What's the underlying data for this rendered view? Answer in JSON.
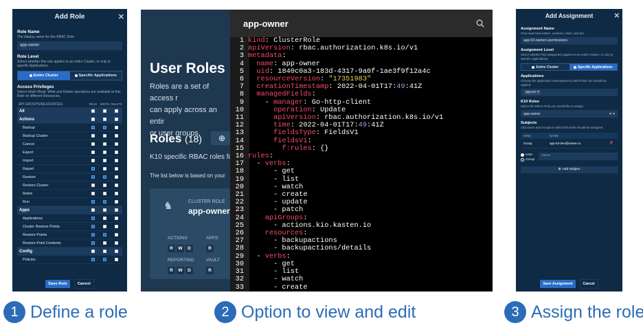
{
  "panel1": {
    "title": "Add Role",
    "role_name_label": "Role Name",
    "role_name_help": "The display name for this RBAC Role.",
    "role_name_value": "app-owner",
    "role_level_label": "Role Level",
    "role_level_help": "Select whether this role applies to an entire Cluster, or only to specific Applications.",
    "opt_cluster": "Entire Cluster",
    "opt_apps": "Specific Applications",
    "access_label": "Access Privileges",
    "access_help": "Select which Read, Write and Delete operations are available to this Role on different Resources.",
    "col_name": "API GROUPS/RESOURCES",
    "col_read": "READ",
    "col_write": "WRITE",
    "col_delete": "DELETE",
    "rows": [
      {
        "name": "All",
        "group": true,
        "r": false,
        "w": false,
        "d": false
      },
      {
        "name": "Actions",
        "group": true,
        "r": false,
        "w": false,
        "d": false
      },
      {
        "name": "Backup",
        "group": false,
        "r": true,
        "w": true,
        "d": false
      },
      {
        "name": "Backup Cluster",
        "group": false,
        "r": false,
        "w": false,
        "d": false
      },
      {
        "name": "Cancel",
        "group": false,
        "r": false,
        "w": false,
        "d": false
      },
      {
        "name": "Export",
        "group": false,
        "r": false,
        "w": false,
        "d": false
      },
      {
        "name": "Import",
        "group": false,
        "r": false,
        "w": false,
        "d": false
      },
      {
        "name": "Report",
        "group": false,
        "r": true,
        "w": false,
        "d": false
      },
      {
        "name": "Restore",
        "group": false,
        "r": true,
        "w": true,
        "d": false
      },
      {
        "name": "Restore Cluster",
        "group": false,
        "r": false,
        "w": false,
        "d": false
      },
      {
        "name": "Retire",
        "group": false,
        "r": false,
        "w": false,
        "d": false
      },
      {
        "name": "Run",
        "group": false,
        "r": true,
        "w": true,
        "d": false
      },
      {
        "name": "Apps",
        "group": true,
        "r": false,
        "w": false,
        "d": false
      },
      {
        "name": "Applications",
        "group": false,
        "r": true,
        "w": false,
        "d": false
      },
      {
        "name": "Cluster Restore Points",
        "group": false,
        "r": true,
        "w": false,
        "d": false
      },
      {
        "name": "Restore Points",
        "group": false,
        "r": true,
        "w": true,
        "d": false
      },
      {
        "name": "Restore Point Contents",
        "group": false,
        "r": true,
        "w": false,
        "d": false
      },
      {
        "name": "Config",
        "group": true,
        "r": false,
        "w": false,
        "d": false
      },
      {
        "name": "Policies",
        "group": false,
        "r": true,
        "w": true,
        "d": false
      }
    ],
    "save": "Save Role",
    "cancel": "Cancel"
  },
  "panel2": {
    "page_title": "User Roles",
    "desc": "Roles are a set of access r... can apply across an entire... or user groups.",
    "desc_lines": [
      "Roles are a set of access r",
      "can apply across an entir",
      "or user groups."
    ],
    "roles_title": "Roles",
    "roles_count": "(18)",
    "k10_text": "K10 specific RBAC roles fo",
    "list_text": "The list below is based on your",
    "card": {
      "type": "CLUSTER ROLE",
      "name": "app-owner",
      "g1": "ACTIONS",
      "g2": "APPS",
      "g3": "REPORTING",
      "g4": "VAULT",
      "r": "R",
      "w": "W",
      "d": "D"
    },
    "editor_title": "app-owner",
    "code": [
      [
        [
          "k",
          "kind"
        ],
        [
          "t",
          ": ClusterRole"
        ]
      ],
      [
        [
          "k",
          "apiVersion"
        ],
        [
          "t",
          ": rbac.authorization.k8s.io/v1"
        ]
      ],
      [
        [
          "k",
          "metadata"
        ],
        [
          "t",
          ":"
        ]
      ],
      [
        [
          "t",
          "  "
        ],
        [
          "k",
          "name"
        ],
        [
          "t",
          ": app-owner"
        ]
      ],
      [
        [
          "t",
          "  "
        ],
        [
          "k",
          "uid"
        ],
        [
          "t",
          ": 1840c0a3-183d-4317-9a0f-1ae3f9f12a4c"
        ]
      ],
      [
        [
          "t",
          "  "
        ],
        [
          "k",
          "resourceVersion"
        ],
        [
          "t",
          ": "
        ],
        [
          "s",
          "\"17351983\""
        ]
      ],
      [
        [
          "t",
          "  "
        ],
        [
          "k",
          "creationTimestamp"
        ],
        [
          "t",
          ": 2022-04-01T17:"
        ],
        [
          "pu",
          "49"
        ],
        [
          "t",
          ":41Z"
        ]
      ],
      [
        [
          "t",
          "  "
        ],
        [
          "k",
          "managedFields"
        ],
        [
          "t",
          ":"
        ]
      ],
      [
        [
          "t",
          "    - "
        ],
        [
          "k",
          "manager"
        ],
        [
          "t",
          ": Go-http-client"
        ]
      ],
      [
        [
          "t",
          "      "
        ],
        [
          "k",
          "operation"
        ],
        [
          "t",
          ": Update"
        ]
      ],
      [
        [
          "t",
          "      "
        ],
        [
          "k",
          "apiVersion"
        ],
        [
          "t",
          ": rbac.authorization.k8s.io/v1"
        ]
      ],
      [
        [
          "t",
          "      "
        ],
        [
          "k",
          "time"
        ],
        [
          "t",
          ": 2022-04-01T17:"
        ],
        [
          "pu",
          "49"
        ],
        [
          "t",
          ":41Z"
        ]
      ],
      [
        [
          "t",
          "      "
        ],
        [
          "k",
          "fieldsType"
        ],
        [
          "t",
          ": FieldsV1"
        ]
      ],
      [
        [
          "t",
          "      "
        ],
        [
          "k",
          "fieldsV1"
        ],
        [
          "t",
          ":"
        ]
      ],
      [
        [
          "t",
          "        "
        ],
        [
          "k",
          "f:rules"
        ],
        [
          "t",
          ": {}"
        ]
      ],
      [
        [
          "k",
          "rules"
        ],
        [
          "t",
          ":"
        ]
      ],
      [
        [
          "t",
          "  - "
        ],
        [
          "k",
          "verbs"
        ],
        [
          "t",
          ":"
        ]
      ],
      [
        [
          "t",
          "      - get"
        ]
      ],
      [
        [
          "t",
          "      - list"
        ]
      ],
      [
        [
          "t",
          "      - watch"
        ]
      ],
      [
        [
          "t",
          "      - create"
        ]
      ],
      [
        [
          "t",
          "      - update"
        ]
      ],
      [
        [
          "t",
          "      - patch"
        ]
      ],
      [
        [
          "t",
          "    "
        ],
        [
          "k",
          "apiGroups"
        ],
        [
          "t",
          ":"
        ]
      ],
      [
        [
          "t",
          "      - actions.kio.kasten.io"
        ]
      ],
      [
        [
          "t",
          "    "
        ],
        [
          "k",
          "resources"
        ],
        [
          "t",
          ":"
        ]
      ],
      [
        [
          "t",
          "      - backupactions"
        ]
      ],
      [
        [
          "t",
          "      - backupactions/details"
        ]
      ],
      [
        [
          "t",
          "  - "
        ],
        [
          "k",
          "verbs"
        ],
        [
          "t",
          ":"
        ]
      ],
      [
        [
          "t",
          "      - get"
        ]
      ],
      [
        [
          "t",
          "      - list"
        ]
      ],
      [
        [
          "t",
          "      - watch"
        ]
      ],
      [
        [
          "t",
          "      - create"
        ]
      ]
    ]
  },
  "panel3": {
    "title": "Add Assignment",
    "name_label": "Assignment Name",
    "name_help": "Only lowercase letters, numbers, dash, and dot.",
    "name_value": "app-53-owners-permissions",
    "level_label": "Assignment Level",
    "level_help": "Select whether this assignment applies to an entire Cluster, or only to specific Applications.",
    "opt_cluster": "Entire Cluster",
    "opt_apps": "Specific Applications",
    "apps_label": "Applications",
    "apps_help": "Choose the application namespaces to which this role should be applied.",
    "app_tag": "app-53",
    "roles_label": "K10 Roles",
    "roles_help": "Select the RBAC Role you would like to assign.",
    "role_value": "app-owner",
    "subjects_label": "Subjects",
    "subjects_help": "Add Users and Groups to which this Role should be assigned.",
    "col_kind": "KIND",
    "col_name": "NAME",
    "subject_kind": "Group",
    "subject_name": "app-53-dev@kasten.io",
    "radio_user": "User",
    "radio_group": "Group",
    "name_placeholder": "Name",
    "add_subject": "Add Subject",
    "save": "Save Assignment",
    "cancel": "Cancel"
  },
  "captions": [
    {
      "num": "1",
      "text": "Define a role"
    },
    {
      "num": "2",
      "text": "Option to view and edit"
    },
    {
      "num": "3",
      "text": "Assign the role"
    }
  ],
  "colors": {
    "accent": "#2b6cb8",
    "panel_bg": "#0f2a44",
    "editor_key": "#f34e6a",
    "editor_string": "#f3d44b",
    "editor_number": "#b894ff"
  }
}
